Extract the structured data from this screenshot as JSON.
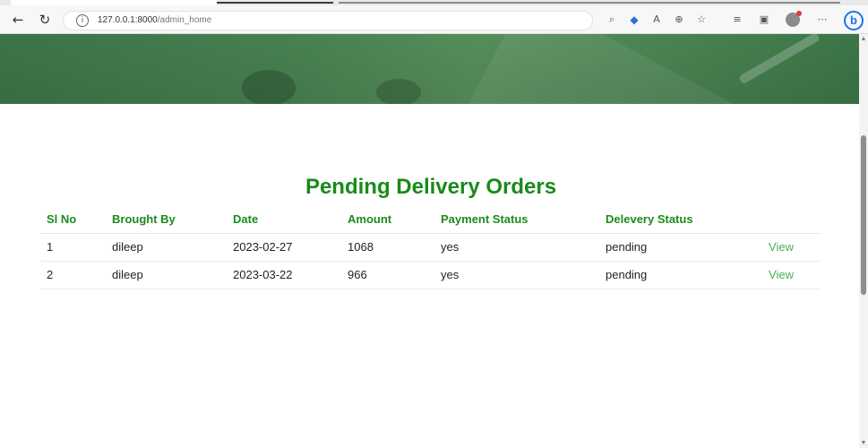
{
  "browser": {
    "url_host": "127.0.0.1:8000",
    "url_path": "/admin_home",
    "icons": [
      "back-icon",
      "reload-icon",
      "info-icon",
      "search-icon",
      "tag-icon",
      "read-aloud-icon",
      "zoom-icon",
      "favorite-add-icon",
      "favorites-icon",
      "collections-icon",
      "profile-avatar",
      "more-icon",
      "bing-icon"
    ]
  },
  "page": {
    "title": "Pending Delivery Orders",
    "table": {
      "headers": [
        "Sl No",
        "Brought By",
        "Date",
        "Amount",
        "Payment Status",
        "Delevery Status",
        ""
      ],
      "rows": [
        {
          "sl": "1",
          "by": "dileep",
          "date": "2023-02-27",
          "amount": "1068",
          "payment": "yes",
          "delivery": "pending",
          "action": "View"
        },
        {
          "sl": "2",
          "by": "dileep",
          "date": "2023-03-22",
          "amount": "966",
          "payment": "yes",
          "delivery": "pending",
          "action": "View"
        }
      ]
    }
  },
  "colors": {
    "accent_green": "#1a8a1a",
    "link_green": "#4caf50",
    "banner_green": "#4b8856"
  }
}
